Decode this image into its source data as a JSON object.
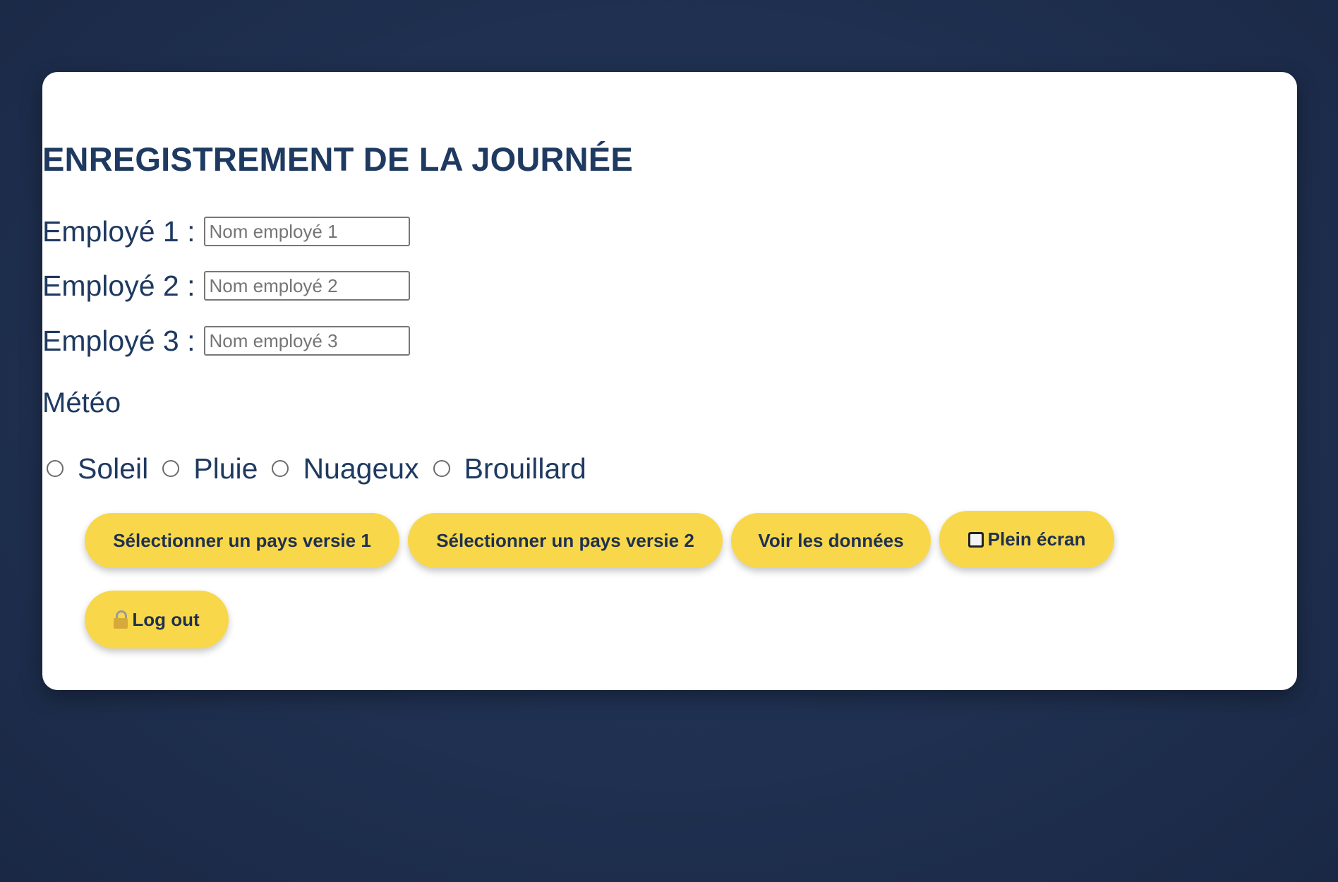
{
  "form": {
    "title": "ENREGISTREMENT DE LA JOURNÉE",
    "employees": [
      {
        "label": "Employé 1 :",
        "placeholder": "Nom employé 1",
        "value": ""
      },
      {
        "label": "Employé 2 :",
        "placeholder": "Nom employé 2",
        "value": ""
      },
      {
        "label": "Employé 3 :",
        "placeholder": "Nom employé 3",
        "value": ""
      }
    ],
    "weather": {
      "title": "Météo",
      "options": [
        "Soleil",
        "Pluie",
        "Nuageux",
        "Brouillard"
      ],
      "selected": null
    }
  },
  "buttons": {
    "select_country_v1": "Sélectionner un pays versie 1",
    "select_country_v2": "Sélectionner un pays versie 2",
    "view_data": "Voir les données",
    "fullscreen": "Plein écran",
    "fullscreen_icon": "fullscreen-square-icon",
    "logout": "Log out",
    "logout_icon": "lock-icon"
  },
  "colors": {
    "background": "#1f3050",
    "card": "#ffffff",
    "text": "#1f3a60",
    "button": "#f8d84a"
  }
}
